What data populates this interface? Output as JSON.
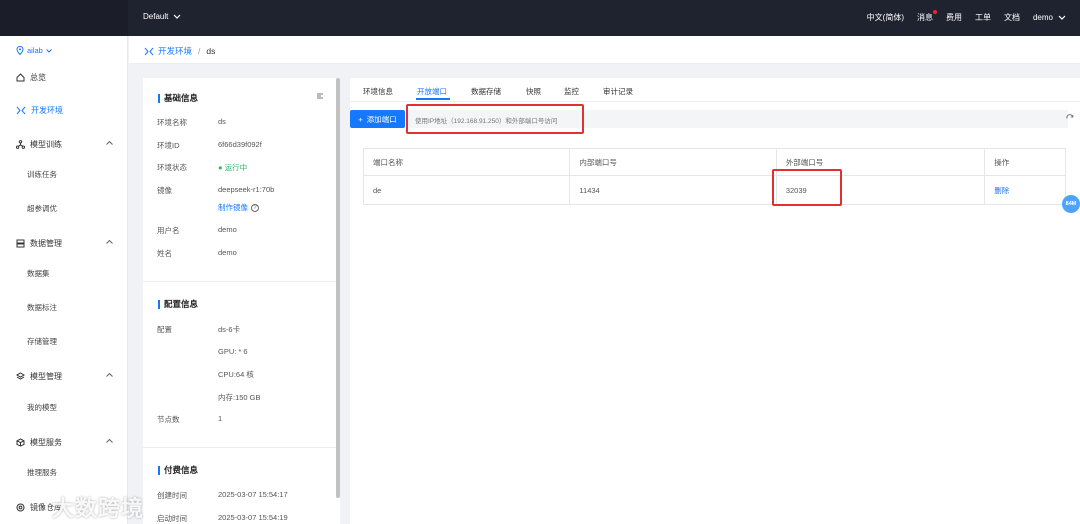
{
  "topbar": {
    "project": "Default",
    "language": "中文(简体)",
    "messages": "消息",
    "billing": "费用",
    "tickets": "工单",
    "docs": "文档",
    "user": "demo"
  },
  "sidebar": {
    "workspace": "ailab",
    "items": [
      {
        "label": "总览"
      },
      {
        "label": "开发环境"
      },
      {
        "label": "模型训练",
        "children": [
          "训练任务",
          "超参调优"
        ]
      },
      {
        "label": "数据管理",
        "children": [
          "数据集",
          "数据标注",
          "存储管理"
        ]
      },
      {
        "label": "模型管理",
        "children": [
          "我的模型"
        ]
      },
      {
        "label": "模型服务",
        "children": [
          "推理服务",
          "镜像仓库"
        ]
      }
    ]
  },
  "breadcrumb": {
    "parent": "开发环境",
    "current": "ds"
  },
  "basic_info": {
    "title": "基础信息",
    "rows": [
      {
        "label": "环境名称",
        "value": "ds"
      },
      {
        "label": "环境ID",
        "value": "6f66d39f092f"
      },
      {
        "label": "环境状态",
        "value": "运行中"
      },
      {
        "label": "镜像",
        "value": "deepseek-r1:70b"
      },
      {
        "label": "",
        "value": "制作镜像"
      },
      {
        "label": "用户名",
        "value": "demo"
      },
      {
        "label": "姓名",
        "value": "demo"
      }
    ]
  },
  "config_info": {
    "title": "配置信息",
    "rows": [
      {
        "label": "配置",
        "value": "ds-6卡"
      },
      {
        "label": "",
        "value": "GPU: * 6"
      },
      {
        "label": "",
        "value": "CPU:64 核"
      },
      {
        "label": "",
        "value": "内存:150 GB"
      },
      {
        "label": "节点数",
        "value": "1"
      }
    ]
  },
  "billing_info": {
    "title": "付费信息",
    "rows": [
      {
        "label": "创建时间",
        "value": "2025-03-07 15:54:17"
      },
      {
        "label": "启动时间",
        "value": "2025-03-07 15:54:19"
      }
    ]
  },
  "tabs": [
    "环境信息",
    "开放端口",
    "数据存储",
    "快照",
    "监控",
    "审计记录"
  ],
  "ports": {
    "add_button": "添加端口",
    "hint": "使用IP地址（192.168.91.250）和外部端口号访问",
    "columns": [
      "端口名称",
      "内部端口号",
      "外部端口号",
      "操作"
    ],
    "rows": [
      {
        "name": "de",
        "internal": "11434",
        "external": "32039",
        "action": "删除"
      }
    ]
  },
  "memory_badge": "84M",
  "watermark": "大数跨境"
}
